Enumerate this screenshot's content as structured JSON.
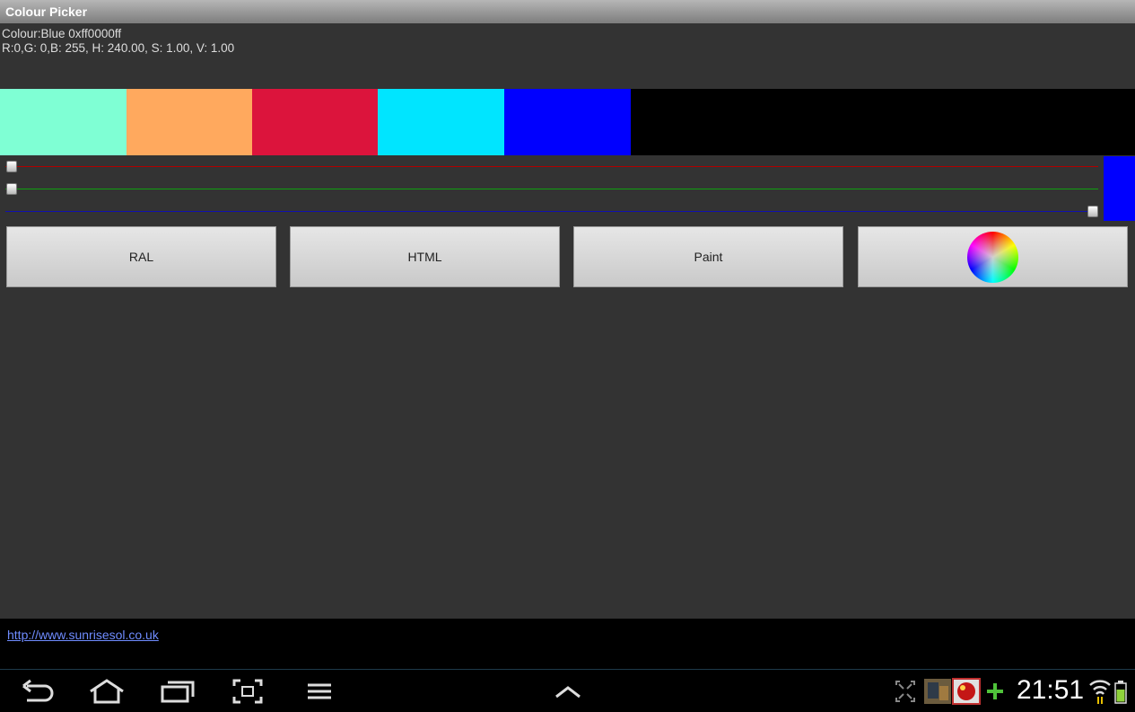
{
  "window": {
    "title": "Colour Picker"
  },
  "info": {
    "line1": "Colour:Blue 0xff0000ff",
    "line2": "R:0,G: 0,B: 255, H: 240.00, S: 1.00, V: 1.00"
  },
  "swatches": [
    "#7fffd4",
    "#ffa95e",
    "#dc143c",
    "#00e5ff",
    "#0000ff"
  ],
  "sliders": {
    "red": {
      "value": 0,
      "max": 255,
      "color": "#b00000"
    },
    "green": {
      "value": 0,
      "max": 255,
      "color": "#10a010"
    },
    "blue": {
      "value": 255,
      "max": 255,
      "color": "#1010b0"
    }
  },
  "preview_color": "#0000ff",
  "buttons": {
    "ral": "RAL",
    "html": "HTML",
    "paint": "Paint",
    "wheel_icon": "colour-wheel-icon"
  },
  "footer": {
    "link": "http://www.sunrisesol.co.uk"
  },
  "status": {
    "time": "21:51"
  }
}
